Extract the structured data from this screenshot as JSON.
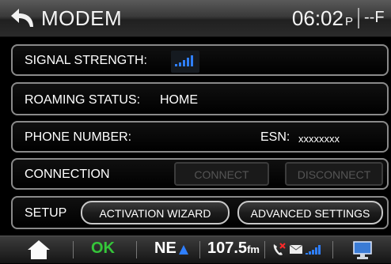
{
  "header": {
    "title": "MODEM",
    "time": "06:02",
    "ampm": "P",
    "outside_temp": "--F",
    "back_icon": "back-arrow-icon"
  },
  "rows": {
    "signal": {
      "label": "SIGNAL STRENGTH:",
      "bars": 5,
      "color": "#2f7fff"
    },
    "roaming": {
      "label": "ROAMING STATUS:",
      "value": "HOME"
    },
    "phone": {
      "label": "PHONE NUMBER:",
      "esn_label": "ESN:",
      "esn_value": "xxxxxxxx"
    },
    "connection": {
      "label": "CONNECTION",
      "connect": "CONNECT",
      "disconnect": "DISCONNECT"
    },
    "setup": {
      "label": "SETUP",
      "activation": "ACTIVATION WIZARD",
      "advanced": "ADVANCED SETTINGS"
    }
  },
  "statusbar": {
    "home_icon": "home-icon",
    "ok": "OK",
    "ok_color": "#35c63a",
    "heading": "NE",
    "heading_icon": "compass-arrow-icon",
    "frequency": "107.5",
    "band": "fm",
    "phone_icon": "phone-missed-icon",
    "mail_icon": "mail-icon",
    "signal_icon": "signal-bars-icon",
    "screen_icon": "display-icon"
  }
}
